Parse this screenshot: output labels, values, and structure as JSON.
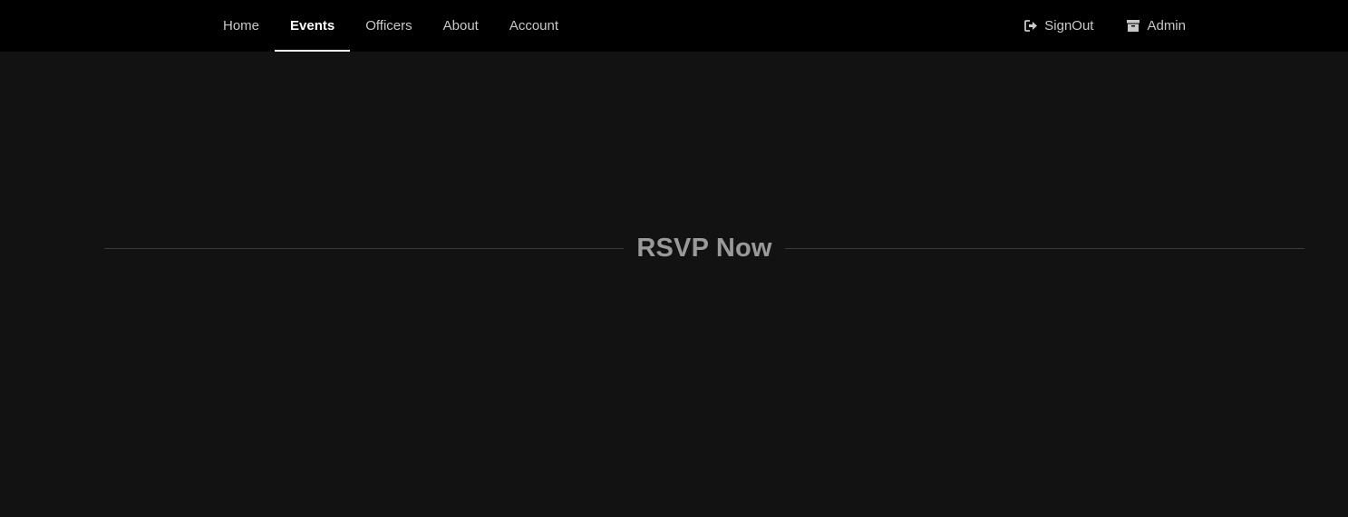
{
  "nav": {
    "left_items": [
      {
        "label": "Home",
        "active": false
      },
      {
        "label": "Events",
        "active": true
      },
      {
        "label": "Officers",
        "active": false
      },
      {
        "label": "About",
        "active": false
      },
      {
        "label": "Account",
        "active": false
      }
    ],
    "right_items": [
      {
        "label": "SignOut",
        "icon": "sign-out-icon"
      },
      {
        "label": "Admin",
        "icon": "archive-icon"
      }
    ]
  },
  "main": {
    "heading": "RSVP Now"
  },
  "colors": {
    "topbar_bg": "#000000",
    "page_bg": "#121212",
    "nav_text": "#c8c8c8",
    "nav_active": "#ffffff",
    "heading_text": "#9a9a9a",
    "divider": "#3a3a3a"
  }
}
